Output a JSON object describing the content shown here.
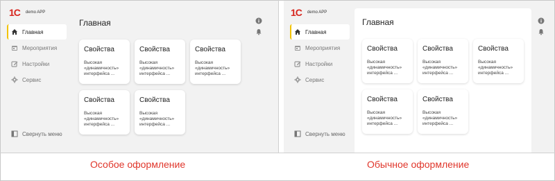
{
  "panels": {
    "left": {
      "logo_mark": "1С",
      "logo_text": "demo APP",
      "nav": [
        {
          "label": "Главная",
          "icon": "home-icon",
          "active": true
        },
        {
          "label": "Мероприятия",
          "icon": "calendar-icon",
          "active": false
        },
        {
          "label": "Настройки",
          "icon": "edit-icon",
          "active": false
        },
        {
          "label": "Сервис",
          "icon": "gear-icon",
          "active": false
        }
      ],
      "collapse_label": "Свернуть меню",
      "page_title": "Главная",
      "cards": [
        {
          "title": "Свойства",
          "desc": [
            "Высокая",
            "«динамичность»",
            "интерфейса ..."
          ]
        },
        {
          "title": "Свойства",
          "desc": [
            "Высокая",
            "«динамичность»",
            "интерфейса ..."
          ]
        },
        {
          "title": "Свойства",
          "desc": [
            "Высокая",
            "«динамичность»",
            "интерфейса ..."
          ]
        },
        {
          "title": "Свойства",
          "desc": [
            "Высокая",
            "«динамичность»",
            "интерфейса ..."
          ]
        },
        {
          "title": "Свойства",
          "desc": [
            "Высокая",
            "«динамичность»",
            "интерфейса ..."
          ]
        }
      ],
      "caption": "Особое оформление"
    },
    "right": {
      "logo_mark": "1С",
      "logo_text": "demo APP",
      "nav": [
        {
          "label": "Главная",
          "icon": "home-icon",
          "active": true
        },
        {
          "label": "Мероприятия",
          "icon": "calendar-icon",
          "active": false
        },
        {
          "label": "Настройки",
          "icon": "edit-icon",
          "active": false
        },
        {
          "label": "Сервис",
          "icon": "gear-icon",
          "active": false
        }
      ],
      "collapse_label": "Свернуть меню",
      "page_title": "Главная",
      "cards": [
        {
          "title": "Свойства",
          "desc": [
            "Высокая",
            "«динамичность»",
            "интерфейса ..."
          ]
        },
        {
          "title": "Свойства",
          "desc": [
            "Высокая",
            "«динамичность»",
            "интерфейса ..."
          ]
        },
        {
          "title": "Свойства",
          "desc": [
            "Высокая",
            "«динамичность»",
            "интерфейса ..."
          ]
        },
        {
          "title": "Свойства",
          "desc": [
            "Высокая",
            "«динамичность»",
            "интерфейса ..."
          ]
        },
        {
          "title": "Свойства",
          "desc": [
            "Высокая",
            "«динамичность»",
            "интерфейса ..."
          ]
        }
      ],
      "caption": "Обычное оформление"
    }
  },
  "colors": {
    "brand_red": "#d7261e",
    "caption_red": "#e0362b",
    "active_accent": "#f2c200",
    "panel_bg": "#f2f2f2",
    "card_bg": "#ffffff"
  }
}
